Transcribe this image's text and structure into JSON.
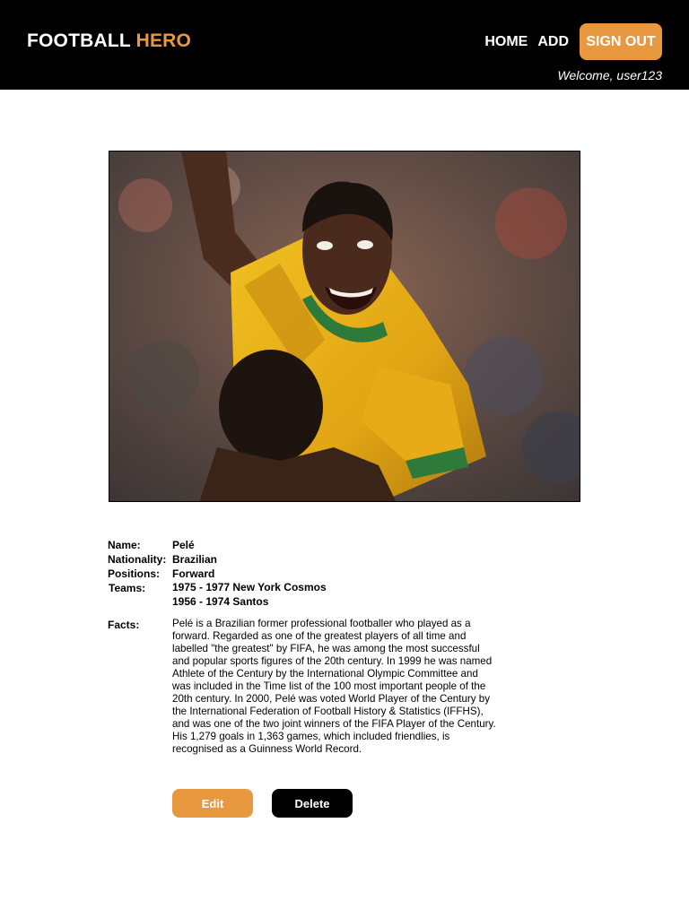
{
  "brand": {
    "part1": "FOOTBALL",
    "part2": "HERO"
  },
  "nav": {
    "home": "HOME",
    "add": "ADD",
    "signout": "SIGN OUT",
    "welcome": "Welcome, user123"
  },
  "colors": {
    "accent": "#e8983e",
    "header_bg": "#000000"
  },
  "player": {
    "labels": {
      "name": "Name:",
      "nationality": "Nationality:",
      "positions": "Positions:",
      "teams": "Teams:",
      "facts": "Facts:"
    },
    "name": "Pelé",
    "nationality": "Brazilian",
    "positions": "Forward",
    "teams": [
      "1975 - 1977 New York Cosmos",
      "1956 - 1974 Santos"
    ],
    "facts": "Pelé is a Brazilian former professional footballer who played as a forward. Regarded as one of the greatest players of all time and labelled \"the greatest\" by FIFA, he was among the most successful and popular sports figures of the 20th century. In 1999 he was named Athlete of the Century by the International Olympic Committee and was included in the Time list of the 100 most important people of the 20th century. In 2000, Pelé was voted World Player of the Century by the International Federation of Football History & Statistics (IFFHS), and was one of the two joint winners of the FIFA Player of the Century. His 1,279 goals in 1,363 games, which included friendlies, is recognised as a Guinness World Record."
  },
  "actions": {
    "edit": "Edit",
    "delete": "Delete"
  }
}
